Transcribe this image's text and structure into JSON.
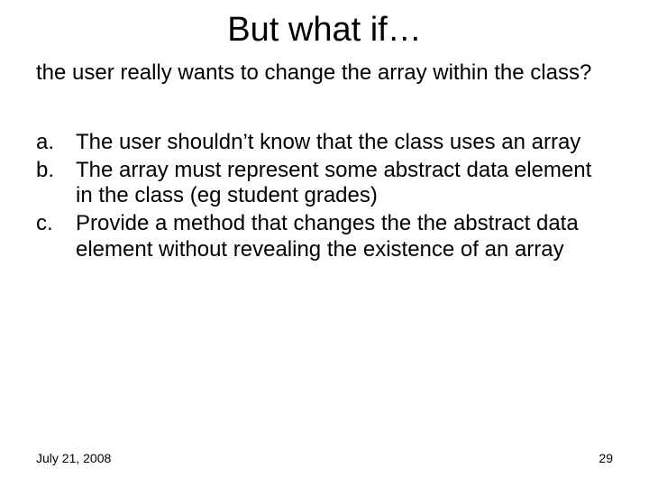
{
  "title": "But what if…",
  "intro": "the user really wants to change the array within the class?",
  "items": [
    {
      "marker": "a.",
      "text": "The user shouldn’t know that the class uses an array"
    },
    {
      "marker": "b.",
      "text": "The array must represent some abstract data element in the class (eg student grades)"
    },
    {
      "marker": "c.",
      "text": "Provide a method that changes the the abstract data element without revealing the existence of an array"
    }
  ],
  "footer": {
    "date": "July 21, 2008",
    "page": "29"
  }
}
